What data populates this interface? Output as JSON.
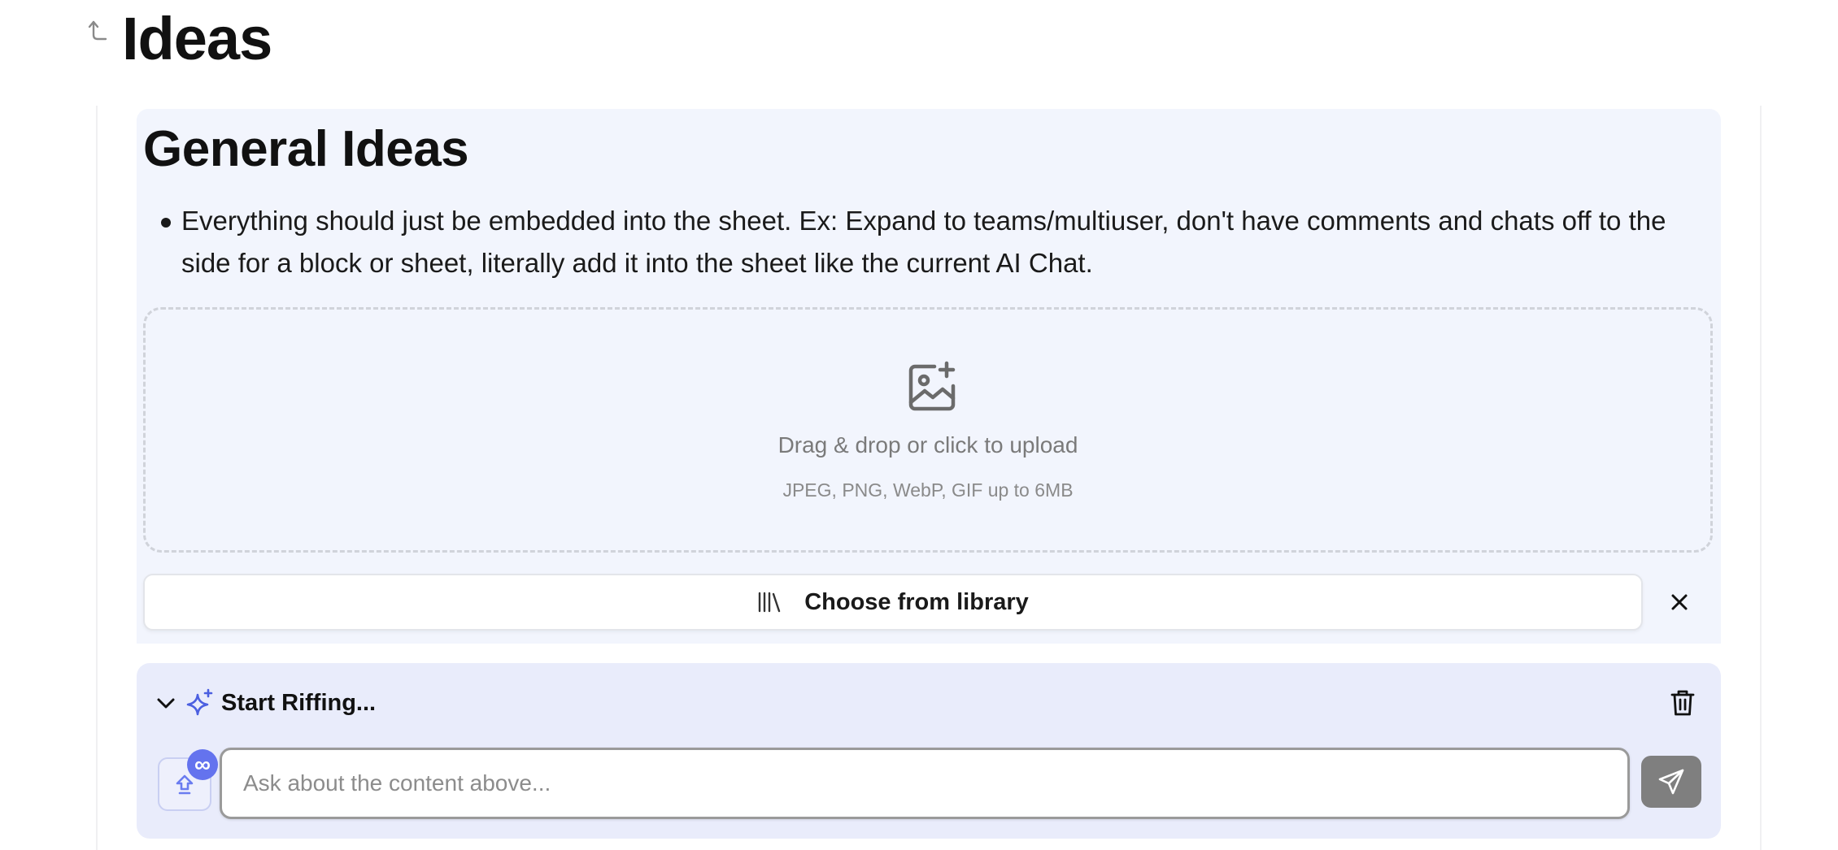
{
  "page": {
    "title": "Ideas",
    "parent_link_icon": "arrow-up-left-icon"
  },
  "block": {
    "title": "General Ideas",
    "bullets": [
      "Everything should just be embedded into the sheet. Ex: Expand to teams/multiuser, don't have comments and chats off to the side for a block or sheet, literally add it into the sheet like the current AI Chat."
    ],
    "upload": {
      "icon": "image-plus-icon",
      "title": "Drag & drop or click to upload",
      "subtitle": "JPEG, PNG, WebP, GIF up to 6MB"
    },
    "library_button": {
      "icon": "library-icon",
      "label": "Choose from library"
    },
    "close_icon": "close-icon"
  },
  "riff": {
    "title": "Start Riffing...",
    "chevron_icon": "chevron-down-icon",
    "sparkle_icon": "sparkle-icon",
    "trash_icon": "trash-icon",
    "attach_icon": "upload-icon",
    "badge_text": "∞",
    "input_placeholder": "Ask about the content above...",
    "input_value": "",
    "send_icon": "send-icon"
  },
  "colors": {
    "block_bg": "#f2f5fd",
    "riff_bg": "#e9ecfb",
    "accent": "#6473ee",
    "send_bg": "#7f7f7f"
  }
}
